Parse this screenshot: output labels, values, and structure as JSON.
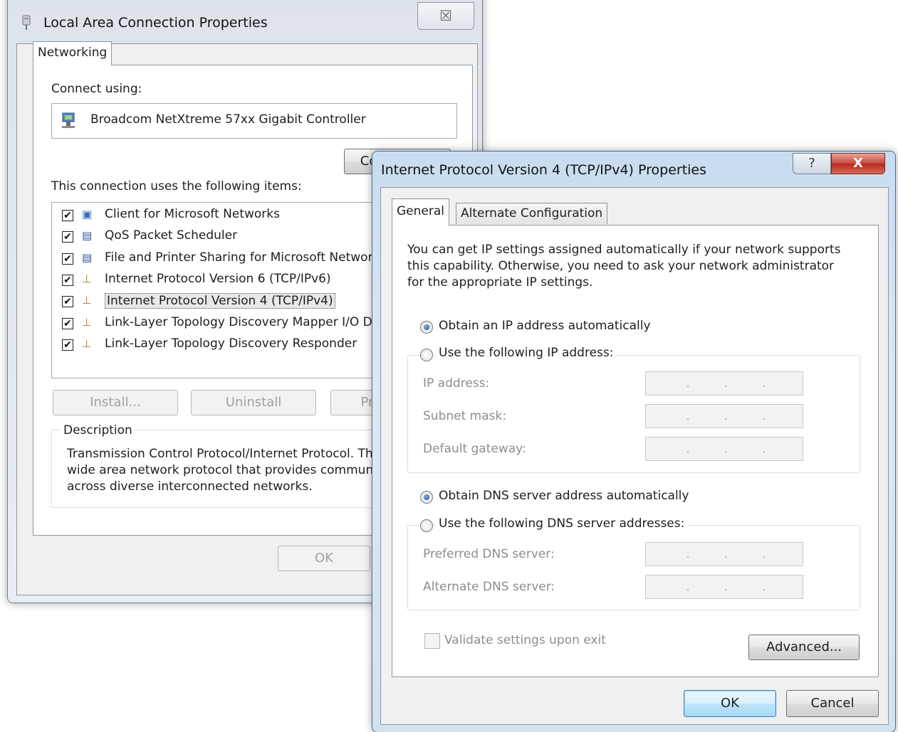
{
  "lac_window": {
    "title": "Local Area Connection Properties",
    "close_glyph": "☒",
    "tab_networking": "Networking",
    "connect_using_label": "Connect using:",
    "adapter_name": "Broadcom NetXtreme 57xx Gigabit Controller",
    "configure_label": "Configure...",
    "items_label": "This connection uses the following items:",
    "items": [
      {
        "label": "Client for Microsoft Networks",
        "checked": true,
        "icon": "network-client-icon"
      },
      {
        "label": "QoS Packet Scheduler",
        "checked": true,
        "icon": "service-icon"
      },
      {
        "label": "File and Printer Sharing for Microsoft Networks",
        "checked": true,
        "icon": "service-icon"
      },
      {
        "label": "Internet Protocol Version 6 (TCP/IPv6)",
        "checked": true,
        "icon": "protocol-icon"
      },
      {
        "label": "Internet Protocol Version 4 (TCP/IPv4)",
        "checked": true,
        "icon": "protocol-icon",
        "selected": true
      },
      {
        "label": "Link-Layer Topology Discovery Mapper I/O Driver",
        "checked": true,
        "icon": "protocol-icon"
      },
      {
        "label": "Link-Layer Topology Discovery Responder",
        "checked": true,
        "icon": "protocol-icon"
      }
    ],
    "install_label": "Install...",
    "uninstall_label": "Uninstall",
    "properties_label": "Properties",
    "description_label": "Description",
    "description_lines": [
      "Transmission Control Protocol/Internet Protocol. The default",
      "wide area network protocol that provides communication",
      "across diverse interconnected networks."
    ],
    "ok_label": "OK"
  },
  "ipv4_window": {
    "title": "Internet Protocol Version 4 (TCP/IPv4) Properties",
    "help_glyph": "?",
    "close_glyph": "X",
    "tab_general": "General",
    "tab_alternate": "Alternate Configuration",
    "intro_lines": [
      "You can get IP settings assigned automatically if your network supports",
      "this capability. Otherwise, you need to ask your network administrator",
      "for the appropriate IP settings."
    ],
    "obtain_ip_auto": "Obtain an IP address automatically",
    "use_following_ip": "Use the following IP address:",
    "ip_address_label": "IP address:",
    "subnet_mask_label": "Subnet mask:",
    "default_gateway_label": "Default gateway:",
    "obtain_dns_auto": "Obtain DNS server address automatically",
    "use_following_dns": "Use the following DNS server addresses:",
    "preferred_dns_label": "Preferred DNS server:",
    "alternate_dns_label": "Alternate DNS server:",
    "validate_label": "Validate settings upon exit",
    "advanced_label": "Advanced...",
    "ok_label": "OK",
    "cancel_label": "Cancel",
    "ip_dot": "."
  }
}
